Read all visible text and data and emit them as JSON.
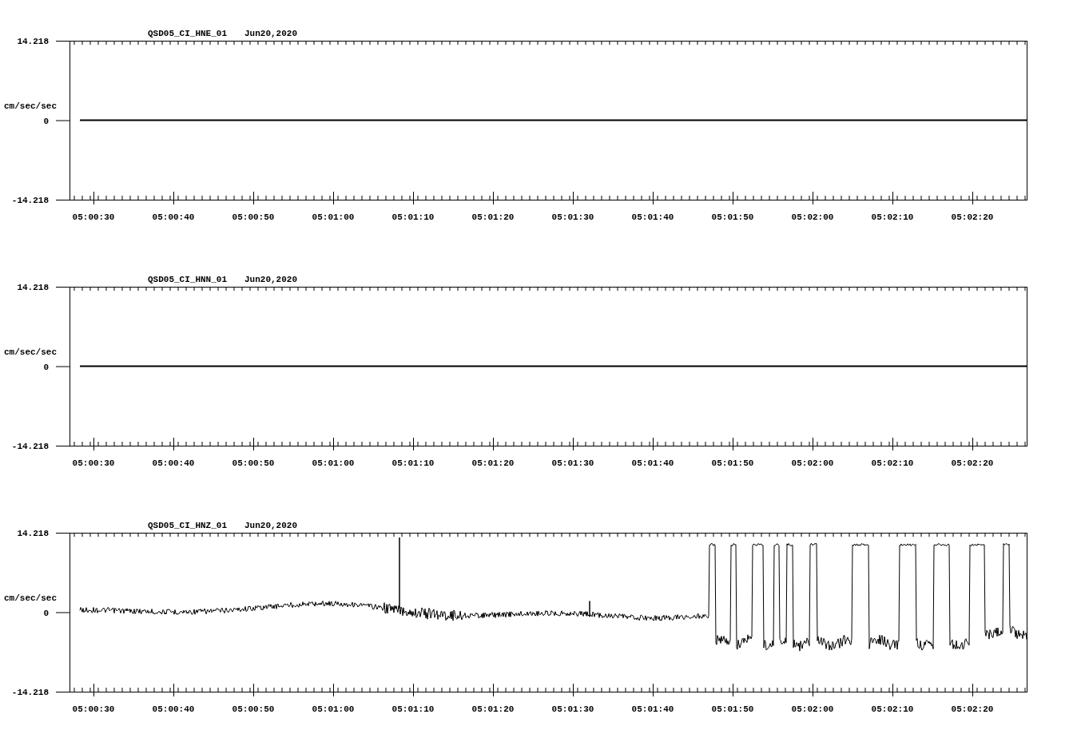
{
  "charts": [
    {
      "station": "QSD05_CI_HNE_01",
      "date": "Jun20,2020",
      "kind": "flat",
      "ylabel": "cm/sec/sec",
      "yticks": [
        "14.218",
        "0",
        "-14.218"
      ],
      "xticks": [
        "05:00:30",
        "05:00:40",
        "05:00:50",
        "05:01:00",
        "05:01:10",
        "05:01:20",
        "05:01:30",
        "05:01:40",
        "05:01:50",
        "05:02:00",
        "05:02:10",
        "05:02:20"
      ]
    },
    {
      "station": "QSD05_CI_HNN_01",
      "date": "Jun20,2020",
      "kind": "flat",
      "ylabel": "cm/sec/sec",
      "yticks": [
        "14.218",
        "0",
        "-14.218"
      ],
      "xticks": [
        "05:00:30",
        "05:00:40",
        "05:00:50",
        "05:01:00",
        "05:01:10",
        "05:01:20",
        "05:01:30",
        "05:01:40",
        "05:01:50",
        "05:02:00",
        "05:02:10",
        "05:02:20"
      ]
    },
    {
      "station": "QSD05_CI_HNZ_01",
      "date": "Jun20,2020",
      "kind": "clipping",
      "ylabel": "cm/sec/sec",
      "yticks": [
        "14.218",
        "0",
        "-14.218"
      ],
      "xticks": [
        "05:00:30",
        "05:00:40",
        "05:00:50",
        "05:01:00",
        "05:01:10",
        "05:01:20",
        "05:01:30",
        "05:01:40",
        "05:01:50",
        "05:02:00",
        "05:02:10",
        "05:02:20"
      ]
    }
  ]
}
